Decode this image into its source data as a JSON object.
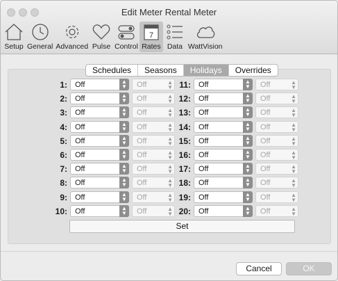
{
  "window": {
    "title": "Edit Meter Rental Meter"
  },
  "toolbar": {
    "items": [
      {
        "label": "Setup",
        "icon": "house-icon"
      },
      {
        "label": "General",
        "icon": "clock-icon"
      },
      {
        "label": "Advanced",
        "icon": "gear-icon"
      },
      {
        "label": "Pulse",
        "icon": "heart-icon"
      },
      {
        "label": "Control",
        "icon": "toggle-icon"
      },
      {
        "label": "Rates",
        "icon": "calendar-icon",
        "badge": "7",
        "active": true
      },
      {
        "label": "Data",
        "icon": "list-icon"
      },
      {
        "label": "WattVision",
        "icon": "cloud-icon"
      }
    ]
  },
  "tabs": [
    "Schedules",
    "Seasons",
    "Holidays",
    "Overrides"
  ],
  "selected_tab": "Holidays",
  "holidays": {
    "left": [
      {
        "num": "1:",
        "value": "Off",
        "secondary": "Off"
      },
      {
        "num": "2:",
        "value": "Off",
        "secondary": "Off"
      },
      {
        "num": "3:",
        "value": "Off",
        "secondary": "Off"
      },
      {
        "num": "4:",
        "value": "Off",
        "secondary": "Off"
      },
      {
        "num": "5:",
        "value": "Off",
        "secondary": "Off"
      },
      {
        "num": "6:",
        "value": "Off",
        "secondary": "Off"
      },
      {
        "num": "7:",
        "value": "Off",
        "secondary": "Off"
      },
      {
        "num": "8:",
        "value": "Off",
        "secondary": "Off"
      },
      {
        "num": "9:",
        "value": "Off",
        "secondary": "Off"
      },
      {
        "num": "10:",
        "value": "Off",
        "secondary": "Off"
      }
    ],
    "right": [
      {
        "num": "11:",
        "value": "Off",
        "secondary": "Off"
      },
      {
        "num": "12:",
        "value": "Off",
        "secondary": "Off"
      },
      {
        "num": "13:",
        "value": "Off",
        "secondary": "Off"
      },
      {
        "num": "14:",
        "value": "Off",
        "secondary": "Off"
      },
      {
        "num": "15:",
        "value": "Off",
        "secondary": "Off"
      },
      {
        "num": "16:",
        "value": "Off",
        "secondary": "Off"
      },
      {
        "num": "17:",
        "value": "Off",
        "secondary": "Off"
      },
      {
        "num": "18:",
        "value": "Off",
        "secondary": "Off"
      },
      {
        "num": "19:",
        "value": "Off",
        "secondary": "Off"
      },
      {
        "num": "20:",
        "value": "Off",
        "secondary": "Off"
      }
    ]
  },
  "set_label": "Set",
  "buttons": {
    "cancel": "Cancel",
    "ok": "OK"
  }
}
